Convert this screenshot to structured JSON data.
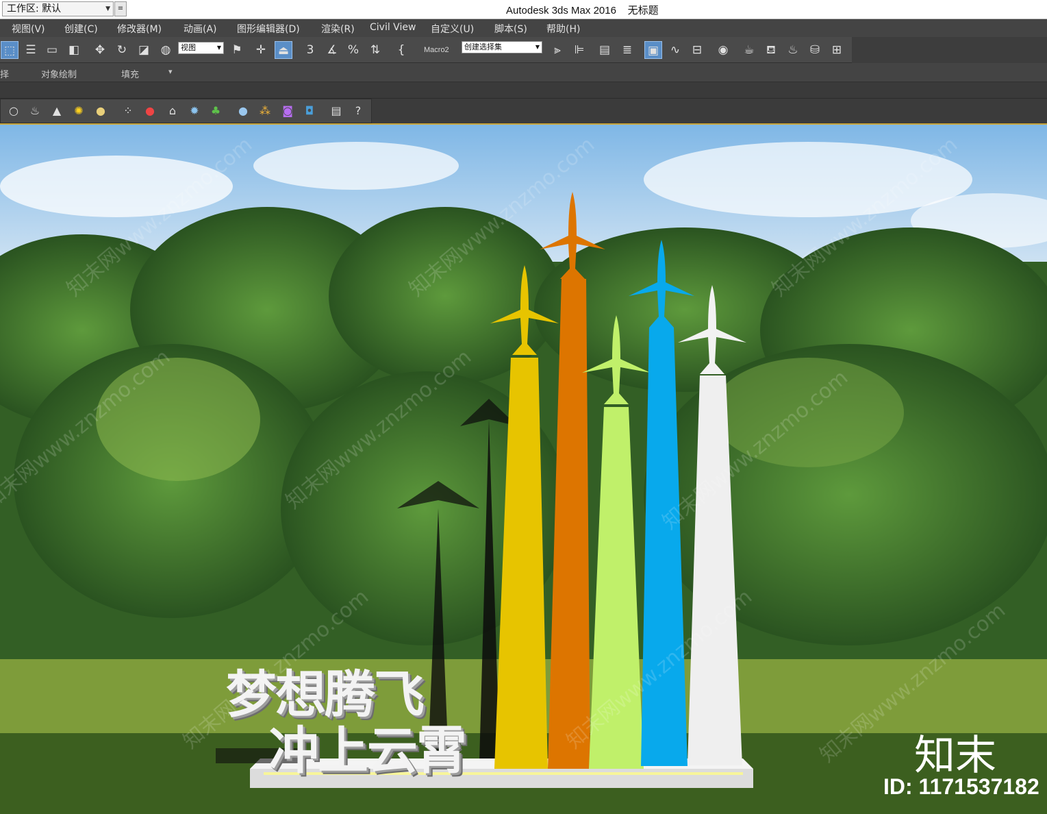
{
  "titlebar": {
    "workspace_label": "工作区: 默认",
    "app_title": "Autodesk 3ds Max 2016    无标题"
  },
  "menu": {
    "items": [
      "视图(V)",
      "创建(C)",
      "修改器(M)",
      "动画(A)",
      "图形编辑器(D)",
      "渲染(R)",
      "Civil View",
      "自定义(U)",
      "脚本(S)",
      "帮助(H)"
    ]
  },
  "toolbar": {
    "view_select": "视图",
    "macro_label": "Macro2",
    "selection_set": "创建选择集",
    "snap_3": "3",
    "snap_percent": "%"
  },
  "ribbon": {
    "tab_cut": "择",
    "tab_object_paint": "对象绘制",
    "tab_populate": "填充"
  },
  "viewport": {
    "slogan_line1": "梦想腾飞",
    "slogan_line2": "冲上云霄",
    "watermark_text": "知末网www.znzmo.com",
    "brand": "知末",
    "id_label": "ID: 1171537182",
    "columns": [
      {
        "name": "yellow",
        "color": "#e7c400"
      },
      {
        "name": "orange",
        "color": "#dd7500"
      },
      {
        "name": "light-green",
        "color": "#c0f06a"
      },
      {
        "name": "blue",
        "color": "#08a9ec"
      },
      {
        "name": "white",
        "color": "#efefef"
      }
    ]
  },
  "colors": {
    "accent_blue": "#5a8ec7",
    "viewport_border": "#c9a63a"
  }
}
